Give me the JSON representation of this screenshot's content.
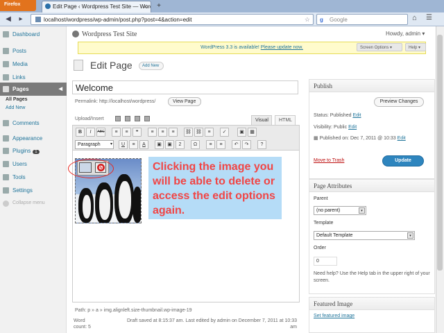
{
  "browser": {
    "app_button": "Firefox",
    "tab_title": "Edit Page ‹ Wordpress Test Site — Word...",
    "url": "localhost/wordpress/wp-admin/post.php?post=4&action=edit",
    "search_placeholder": "Google",
    "search_engine_glyph": "g"
  },
  "sidebar": {
    "items": [
      {
        "label": "Dashboard"
      },
      {
        "label": "Posts"
      },
      {
        "label": "Media"
      },
      {
        "label": "Links"
      },
      {
        "label": "Pages"
      },
      {
        "label": "Comments"
      },
      {
        "label": "Appearance"
      },
      {
        "label": "Plugins",
        "badge": "1"
      },
      {
        "label": "Users"
      },
      {
        "label": "Tools"
      },
      {
        "label": "Settings"
      }
    ],
    "pages_sub": [
      "All Pages",
      "Add New"
    ],
    "collapse": "Collapse menu"
  },
  "header": {
    "site_title": "Wordpress Test Site",
    "howdy": "Howdy, admin ▾",
    "update_nag_prefix": "WordPress 3.3 is available!",
    "update_nag_link": "Please update now.",
    "screen_options": "Screen Options ▾",
    "help": "Help ▾"
  },
  "page": {
    "heading": "Edit Page",
    "add_new": "Add New",
    "title_value": "Welcome",
    "permalink": "Permalink: http://localhost/wordpress/",
    "view_page": "View Page"
  },
  "editor": {
    "upload_label": "Upload/Insert",
    "tab_visual": "Visual",
    "tab_html": "HTML",
    "format_select": "Paragraph",
    "toolbar_row1": [
      "B",
      "I",
      "ABC",
      "≡",
      "≡",
      "❝",
      "≡",
      "≡",
      "≡",
      "⛓",
      "⛓",
      "≡",
      "✓",
      "▣",
      "▦"
    ],
    "toolbar_row2": [
      "U",
      "≡",
      "A",
      "▣",
      "▣",
      "2",
      "Ω",
      "≡",
      "≡",
      "↶",
      "↷",
      "?"
    ],
    "callout": "Clicking the image you will be able to delete or access the edit options again.",
    "path": "Path: p » a » img.alignleft.size-thumbnail.wp-image-19",
    "word_count": "Word count: 5",
    "draft_note": "Draft saved at 8:15:37 am. Last edited by admin on December 7, 2011 at 10:33 am"
  },
  "publish": {
    "title": "Publish",
    "preview": "Preview Changes",
    "status_label": "Status: Published",
    "status_edit": "Edit",
    "visibility_label": "Visibility: Public",
    "visibility_edit": "Edit",
    "published_on": "Published on: Dec 7, 2011 @ 10:33",
    "published_edit": "Edit",
    "trash": "Move to Trash",
    "update": "Update"
  },
  "attributes": {
    "title": "Page Attributes",
    "parent_label": "Parent",
    "parent_value": "(no parent)",
    "template_label": "Template",
    "template_value": "Default Template",
    "order_label": "Order",
    "order_value": "0",
    "help_text": "Need help? Use the Help tab in the upper right of your screen."
  },
  "featured": {
    "title": "Featured Image",
    "link": "Set featured image"
  },
  "colors": {
    "link": "#21759b",
    "callout_bg": "#b5dcf7",
    "callout_text": "#f14545",
    "update_button": "#2e85be",
    "highlight_circle": "#e8261e"
  }
}
